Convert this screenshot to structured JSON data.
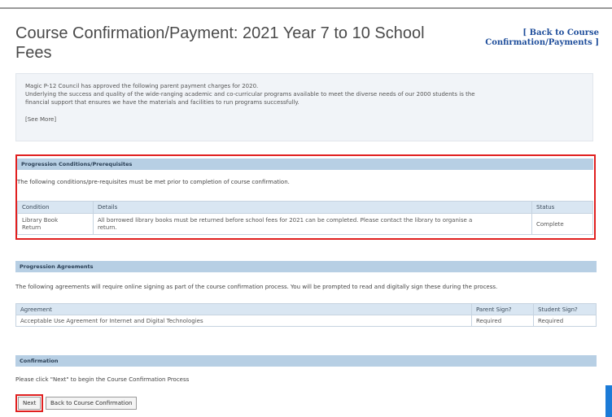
{
  "page": {
    "title": "Course Confirmation/Payment: 2021 Year 7 to 10 School Fees",
    "back_link_line1": "[ Back to Course",
    "back_link_line2": "Confirmation/Payments ]"
  },
  "intro": {
    "line1": "Magic P-12 Council has approved the following parent payment charges for 2020.",
    "line2": "Underlying the success and quality of the wide-ranging academic and co-curricular programs available to meet the diverse needs of our 2000 students is the",
    "line3": "financial support that ensures we have the materials and facilities to run programs successfully.",
    "see_more": "[See More]"
  },
  "conditions": {
    "header": "Progression Conditions/Prerequisites",
    "description": "The following conditions/pre-requisites must be met prior to completion of course confirmation.",
    "columns": [
      "Condition",
      "Details",
      "Status"
    ],
    "row": {
      "condition_line1": "Library Book",
      "condition_line2": "Return",
      "details_line1": "All borrowed library books must be returned before school fees for 2021 can be completed. Please contact the library to organise a",
      "details_line2": "return.",
      "status": "Complete"
    }
  },
  "agreements": {
    "header": "Progression Agreements",
    "description": "The following agreements will require online signing as part of the course confirmation process. You will be prompted to read and digitally sign these during the process.",
    "columns": [
      "Agreement",
      "Parent Sign?",
      "Student Sign?"
    ],
    "row": {
      "agreement": "Acceptable Use Agreement for Internet and Digital Technologies",
      "parent": "Required",
      "student": "Required"
    }
  },
  "confirmation": {
    "header": "Confirmation",
    "description": "Please click \"Next\" to begin the Course Confirmation Process",
    "next_label": "Next",
    "back_label": "Back to Course Confirmation"
  },
  "colors": {
    "highlight": "#e02020",
    "section_header": "#b7cfe4",
    "link": "#1f4e9b",
    "corner_tab": "#1c7bd7"
  }
}
